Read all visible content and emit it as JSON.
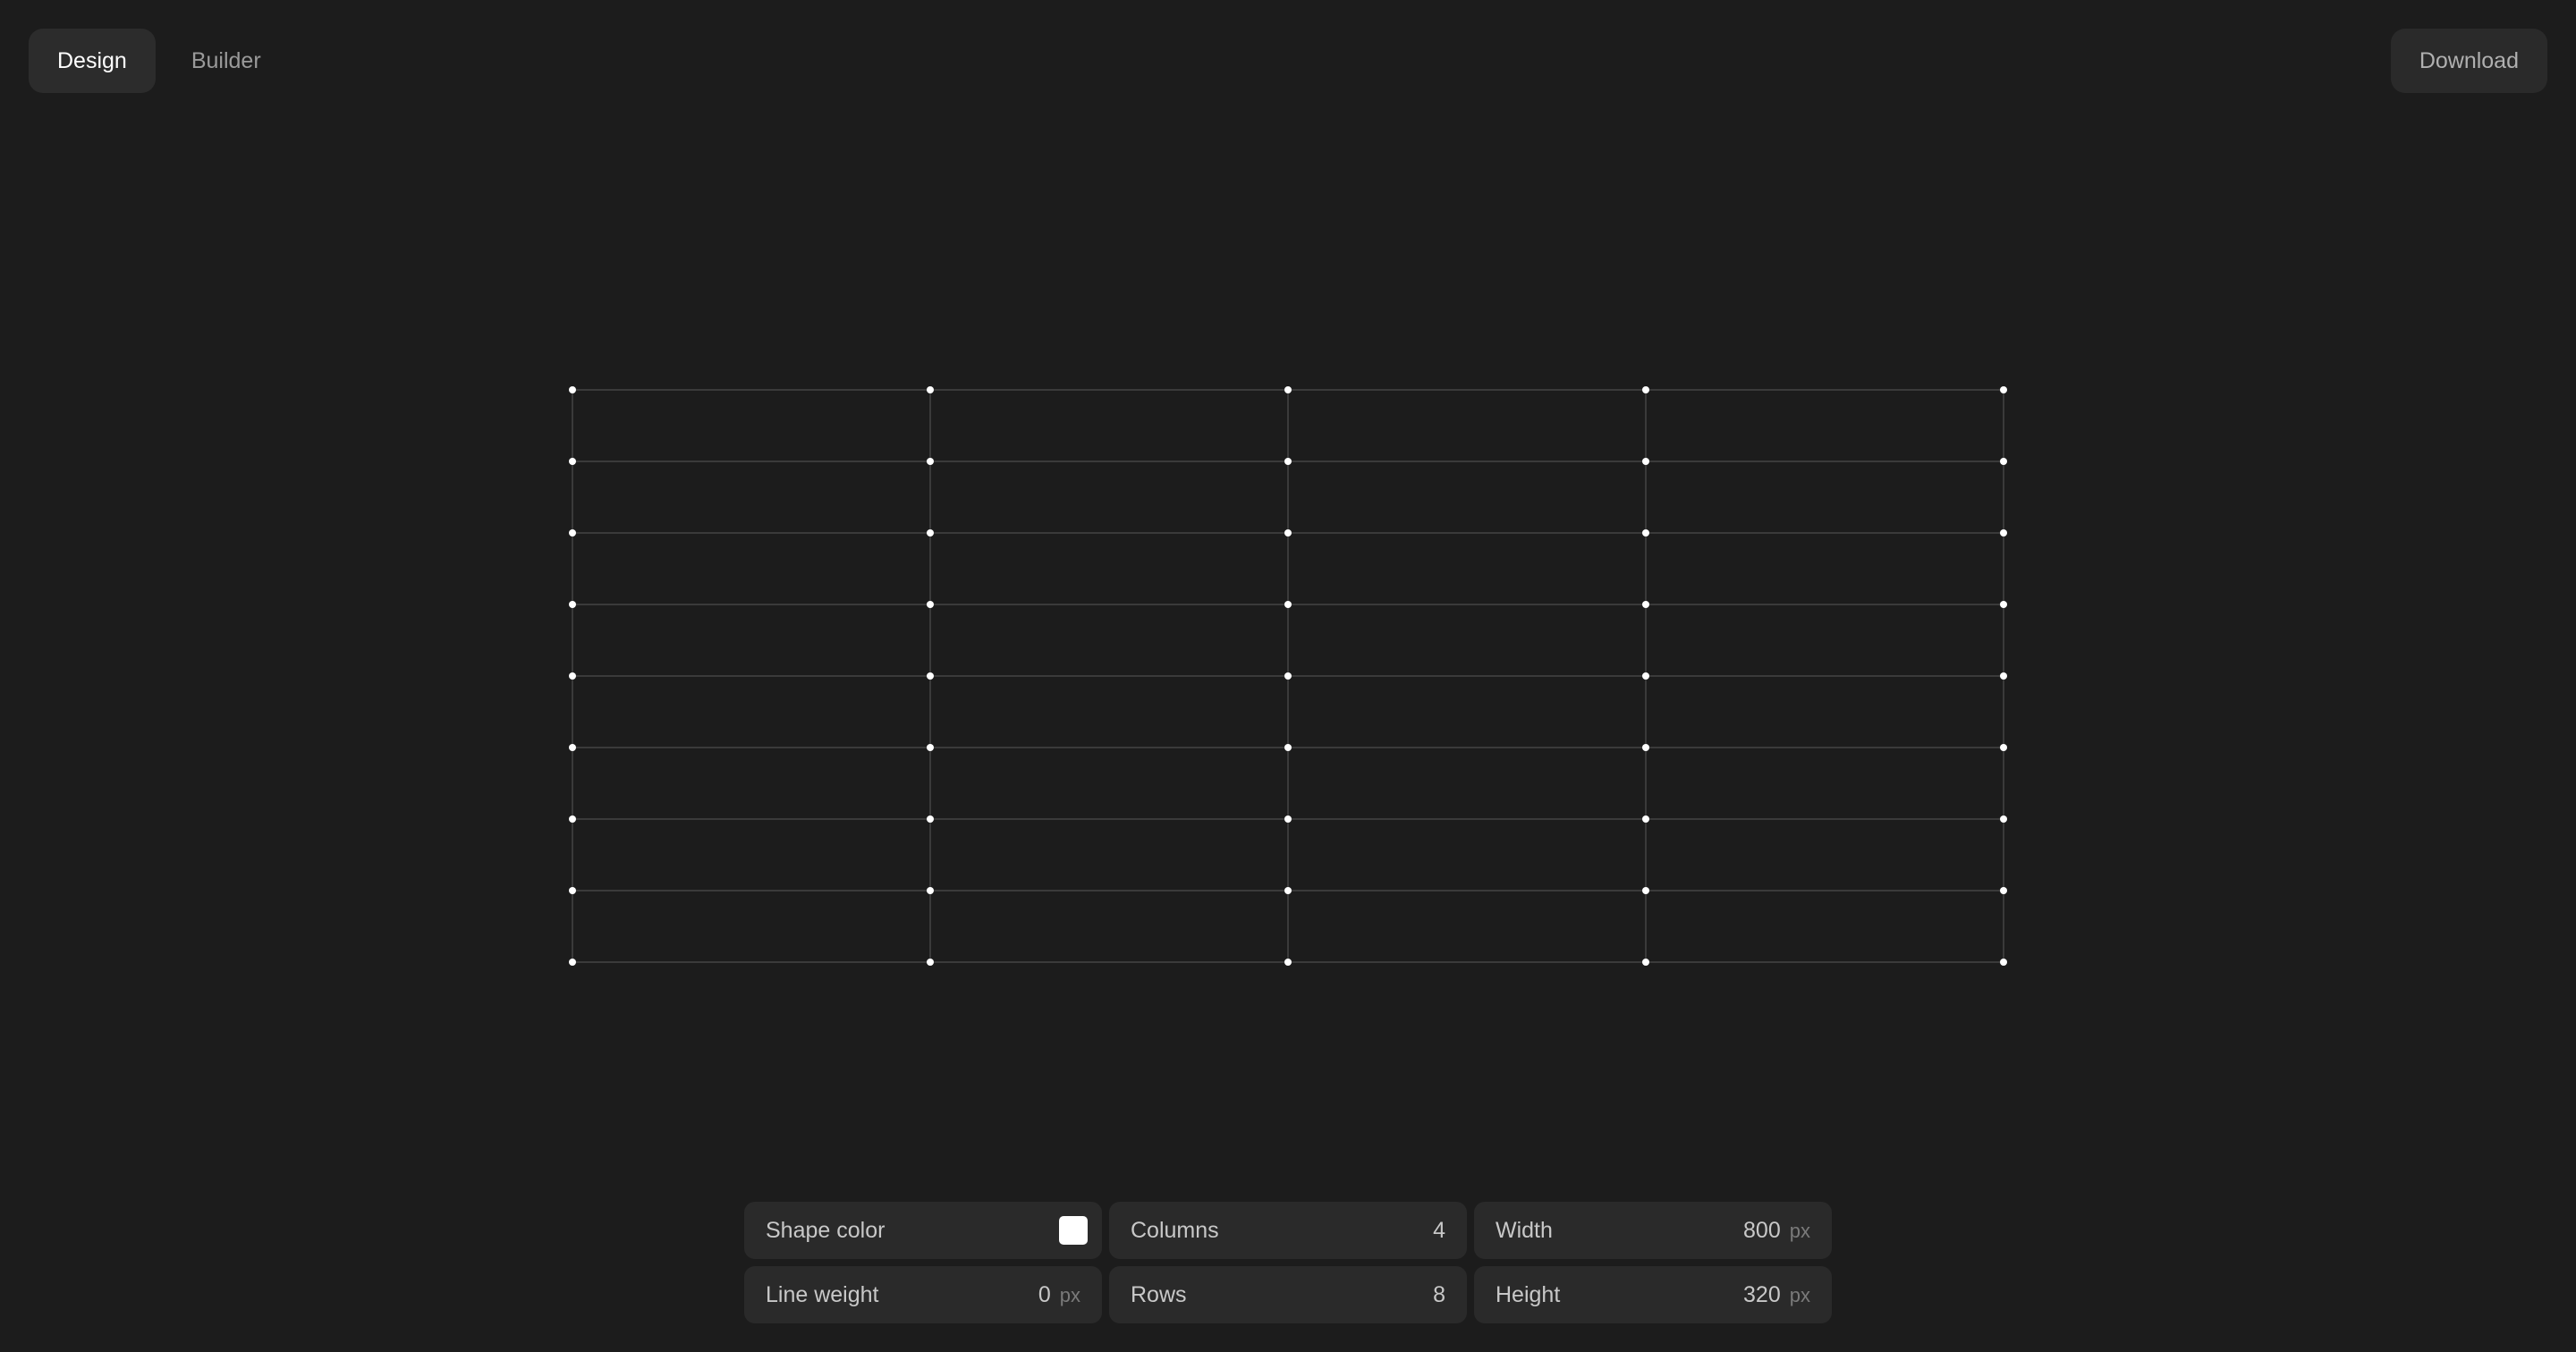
{
  "tabs": [
    {
      "label": "Design",
      "active": true
    },
    {
      "label": "Builder",
      "active": false
    }
  ],
  "download_label": "Download",
  "controls": {
    "shape_color": {
      "label": "Shape color",
      "value": "#ffffff"
    },
    "columns": {
      "label": "Columns",
      "value": "4"
    },
    "width": {
      "label": "Width",
      "value": "800",
      "unit": "px"
    },
    "line_weight": {
      "label": "Line weight",
      "value": "0",
      "unit": "px"
    },
    "rows": {
      "label": "Rows",
      "value": "8"
    },
    "height": {
      "label": "Height",
      "value": "320",
      "unit": "px"
    }
  },
  "colors": {
    "background": "#1c1c1c",
    "grid_line": "#3a3a3a",
    "node": "#ffffff"
  }
}
